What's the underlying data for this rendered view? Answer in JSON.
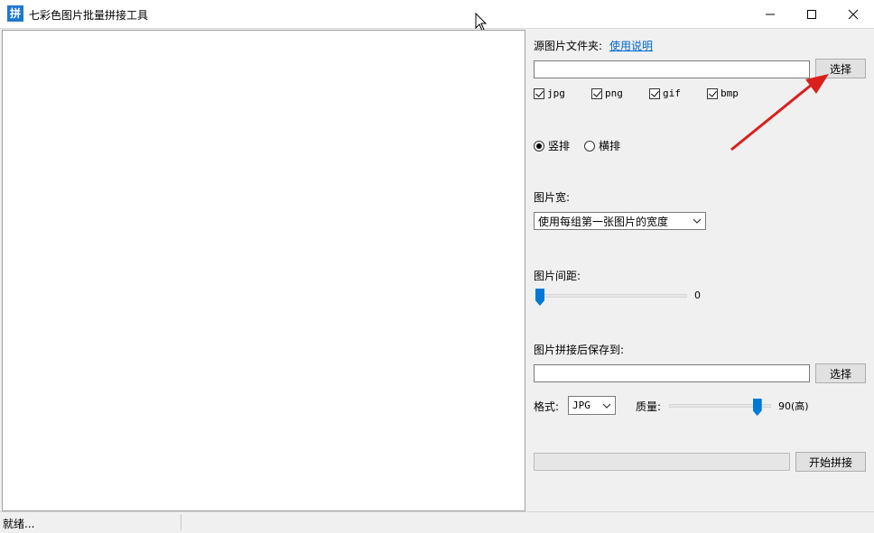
{
  "window": {
    "title": "七彩色图片批量拼接工具",
    "icon_char": "拼"
  },
  "panel": {
    "source_label": "源图片文件夹:",
    "help_link": "使用说明",
    "source_path": "",
    "select_button": "选择",
    "filetypes": [
      "jpg",
      "png",
      "gif",
      "bmp"
    ],
    "orientation": {
      "vertical": "竖排",
      "horizontal": "横排",
      "selected": "竖排"
    },
    "width_label": "图片宽:",
    "width_option": "使用每组第一张图片的宽度",
    "spacing_label": "图片间距:",
    "spacing_value": "0",
    "save_label": "图片拼接后保存到:",
    "save_path": "",
    "save_select_button": "选择",
    "format_label": "格式:",
    "format_value": "JPG",
    "quality_label": "质量:",
    "quality_value": "90(高)",
    "quality_fraction": 0.9,
    "start_button": "开始拼接"
  },
  "status": {
    "text": "就绪..."
  },
  "colors": {
    "accent": "#0078d7",
    "arrow": "#d9201c"
  }
}
